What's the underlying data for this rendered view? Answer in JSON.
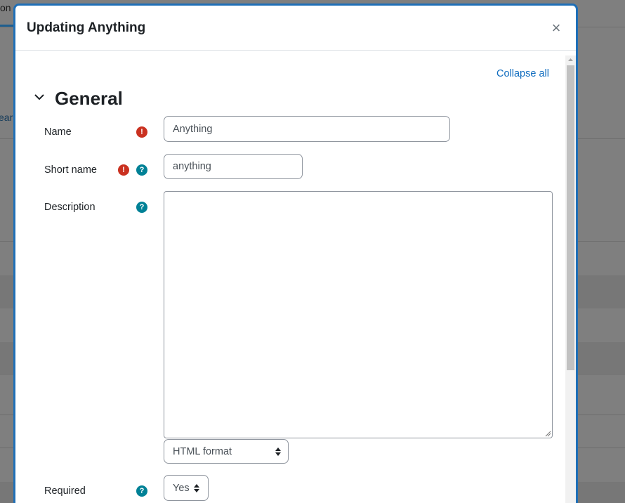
{
  "background": {
    "tab_fragment": "on",
    "link_fragment": "ear"
  },
  "modal": {
    "title": "Updating Anything",
    "close_symbol": "×",
    "collapse_all": "Collapse all",
    "section": {
      "title": "General",
      "icon": "chevron-down-icon"
    },
    "fields": {
      "name": {
        "label": "Name",
        "value": "Anything",
        "required_icon": "!"
      },
      "short_name": {
        "label": "Short name",
        "value": "anything",
        "required_icon": "!",
        "help_icon": "?"
      },
      "description": {
        "label": "Description",
        "value": "",
        "help_icon": "?",
        "format_selected": "HTML format"
      },
      "required": {
        "label": "Required",
        "help_icon": "?",
        "selected": "Yes"
      }
    }
  },
  "colors": {
    "accent": "#0f6cbf",
    "modal_border": "#1f6fb7",
    "required": "#ca3120",
    "help": "#008196"
  }
}
